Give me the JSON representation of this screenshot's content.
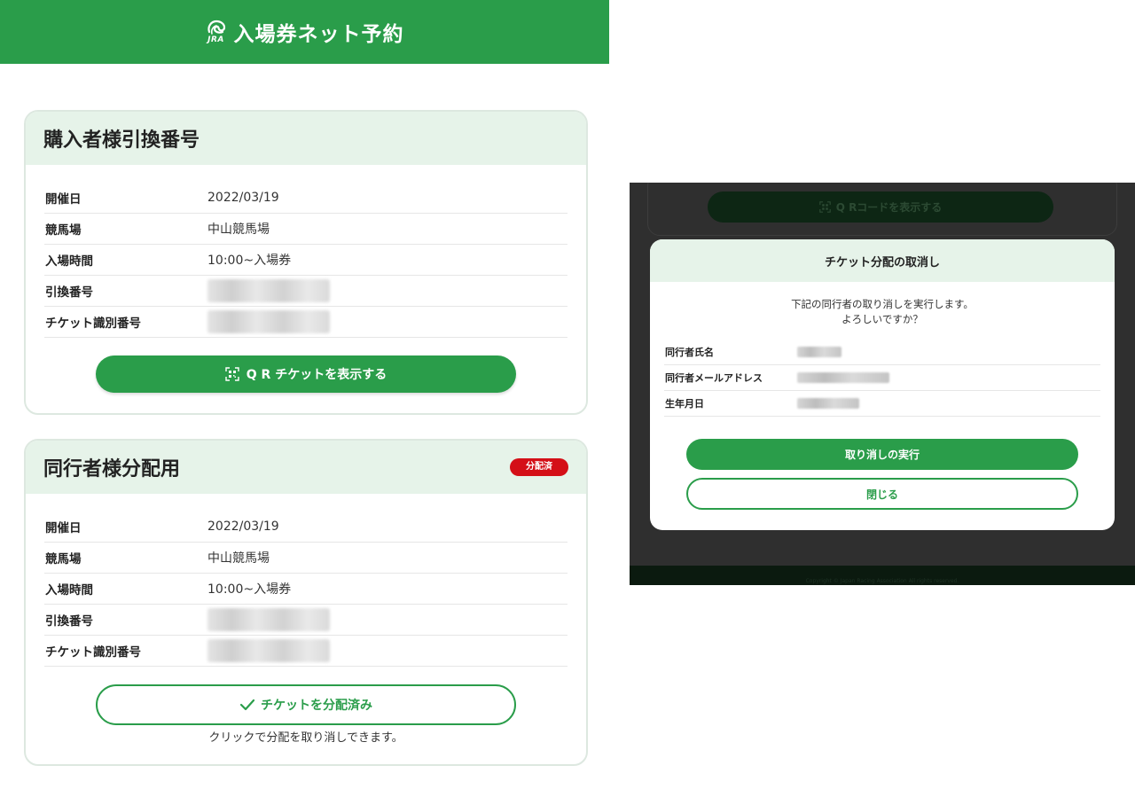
{
  "header": {
    "logo_text": "JRA",
    "title": "入場券ネット予約",
    "color": "#2a9d4a"
  },
  "purchaser_card": {
    "title": "購入者様引換番号",
    "rows": [
      {
        "label": "開催日",
        "value": "2022/03/19"
      },
      {
        "label": "競馬場",
        "value": "中山競馬場"
      },
      {
        "label": "入場時間",
        "value": "10:00~入場券"
      },
      {
        "label": "引換番号",
        "value": ""
      },
      {
        "label": "チケット識別番号",
        "value": ""
      }
    ],
    "button_label": "Q R チケットを表示する",
    "button_icon": "qr-code-icon"
  },
  "companion_card": {
    "title": "同行者様分配用",
    "badge": "分配済",
    "badge_color": "#d40f17",
    "rows": [
      {
        "label": "開催日",
        "value": "2022/03/19"
      },
      {
        "label": "競馬場",
        "value": "中山競馬場"
      },
      {
        "label": "入場時間",
        "value": "10:00~入場券"
      },
      {
        "label": "引換番号",
        "value": ""
      },
      {
        "label": "チケット識別番号",
        "value": ""
      }
    ],
    "button_label": "チケットを分配済み",
    "button_icon": "checkmark-icon",
    "helper_text": "クリックで分配を取り消しできます。"
  },
  "background_screen": {
    "qr_button_label": "Q Rコードを表示する",
    "footer_text": "Copyright © Japan Racing Association All rights reserved."
  },
  "modal": {
    "title": "チケット分配の取消し",
    "message_line1": "下記の同行者の取り消しを実行します。",
    "message_line2": "よろしいですか？",
    "rows": [
      {
        "label": "同行者氏名"
      },
      {
        "label": "同行者メールアドレス"
      },
      {
        "label": "生年月日"
      }
    ],
    "confirm_label": "取り消しの実行",
    "close_label": "閉じる"
  }
}
